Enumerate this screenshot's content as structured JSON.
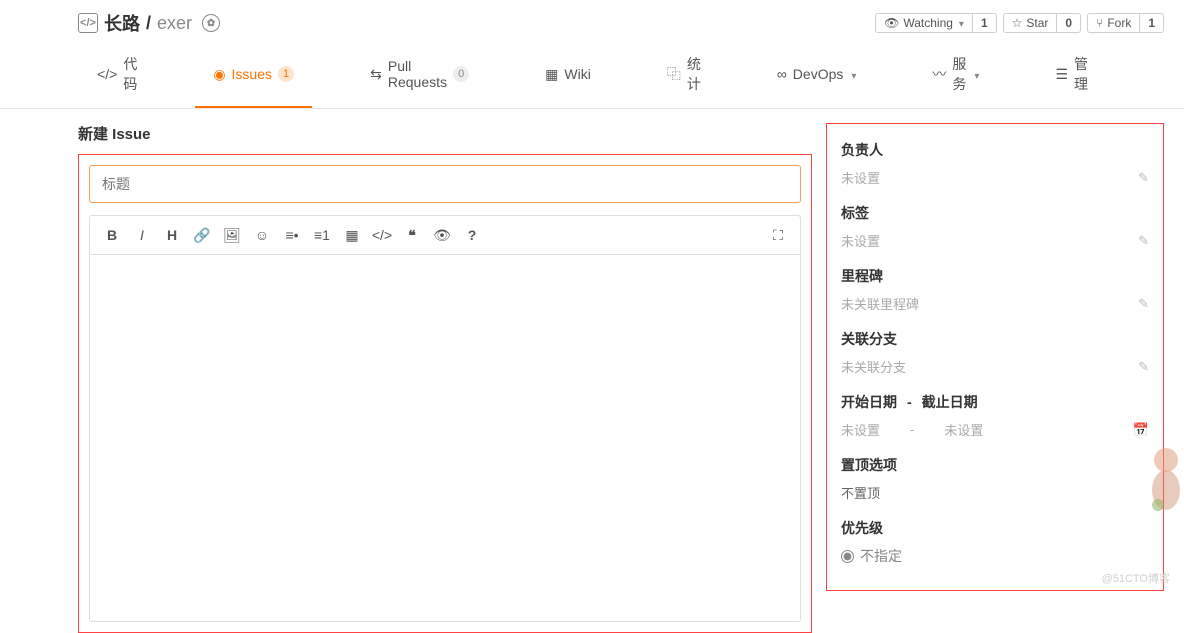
{
  "header": {
    "owner": "长路",
    "sep": "/",
    "repo": "exer",
    "watching_label": "Watching",
    "watching_count": "1",
    "star_label": "Star",
    "star_count": "0",
    "fork_label": "Fork",
    "fork_count": "1"
  },
  "tabs": {
    "code": "代码",
    "issues": "Issues",
    "issues_count": "1",
    "pr": "Pull Requests",
    "pr_count": "0",
    "wiki": "Wiki",
    "stats": "统计",
    "devops": "DevOps",
    "services": "服务",
    "manage": "管理"
  },
  "page": {
    "title": "新建 Issue"
  },
  "editor": {
    "title_placeholder": "标题"
  },
  "sidebar": {
    "assignee": {
      "label": "负责人",
      "value": "未设置"
    },
    "labels": {
      "label": "标签",
      "value": "未设置"
    },
    "milestone": {
      "label": "里程碑",
      "value": "未关联里程碑"
    },
    "branch": {
      "label": "关联分支",
      "value": "未关联分支"
    },
    "dates": {
      "start_label": "开始日期",
      "sep": "-",
      "end_label": "截止日期",
      "start_value": "未设置",
      "mid_sep": "-",
      "end_value": "未设置"
    },
    "sticky": {
      "label": "置顶选项",
      "value": "不置顶"
    },
    "priority": {
      "label": "优先级",
      "value": "不指定"
    }
  },
  "watermark": "@51CTO博客"
}
